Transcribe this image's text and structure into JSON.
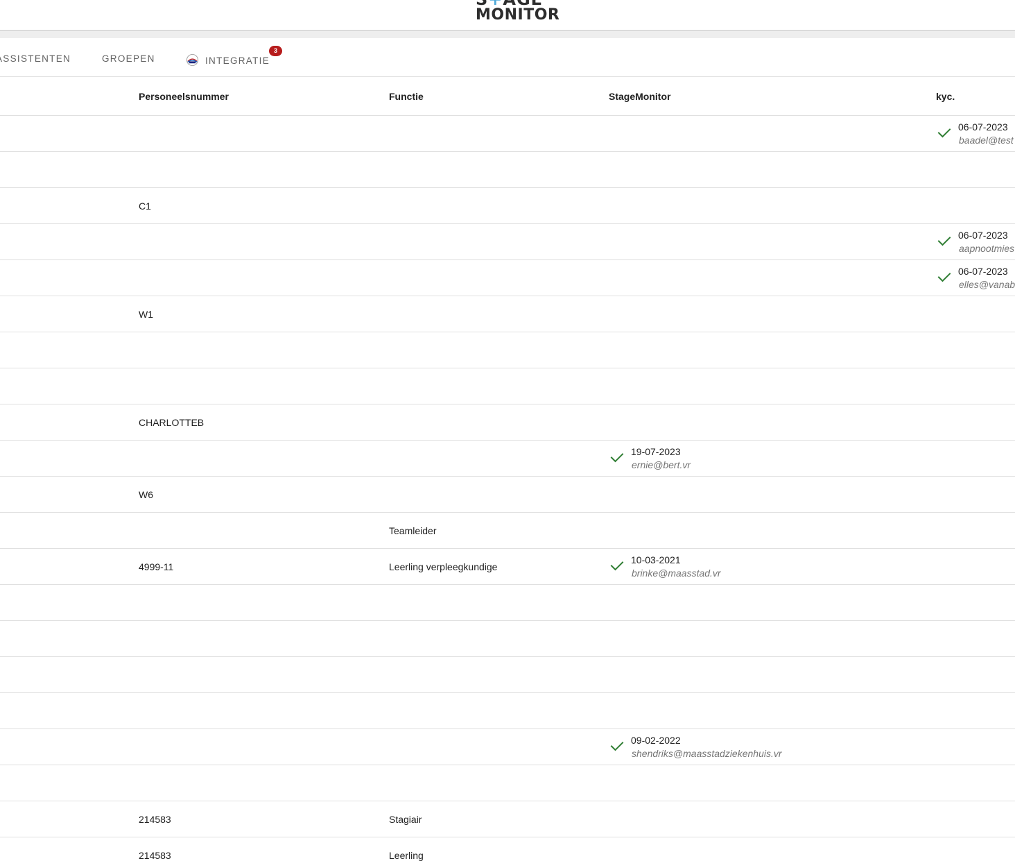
{
  "header": {
    "logo_top_left": "S",
    "logo_top_plus": "+",
    "logo_top_right": "AGE",
    "logo_bottom": "MONITOR"
  },
  "tabs": [
    {
      "label": "ASSISTENTEN"
    },
    {
      "label": "GROEPEN"
    },
    {
      "label": "INTEGRATIE",
      "badge": "3",
      "icon": "integration-logo-icon"
    }
  ],
  "table": {
    "columns": [
      "Personeelsnummer",
      "Functie",
      "StageMonitor",
      "kyc."
    ],
    "rows": [
      {
        "pers": "",
        "func": "",
        "stage": null,
        "kyc": {
          "date": "06-07-2023",
          "email": "baadel@test"
        }
      },
      {
        "pers": "",
        "func": "",
        "stage": null,
        "kyc": null
      },
      {
        "pers": "C1",
        "func": "",
        "stage": null,
        "kyc": null
      },
      {
        "pers": "",
        "func": "",
        "stage": null,
        "kyc": {
          "date": "06-07-2023",
          "email": "aapnootmies"
        }
      },
      {
        "pers": "",
        "func": "",
        "stage": null,
        "kyc": {
          "date": "06-07-2023",
          "email": "elles@vanab"
        }
      },
      {
        "pers": "W1",
        "func": "",
        "stage": null,
        "kyc": null
      },
      {
        "pers": "",
        "func": "",
        "stage": null,
        "kyc": null
      },
      {
        "pers": "",
        "func": "",
        "stage": null,
        "kyc": null
      },
      {
        "pers": "CHARLOTTEB",
        "func": "",
        "stage": null,
        "kyc": null
      },
      {
        "pers": "",
        "func": "",
        "stage": {
          "date": "19-07-2023",
          "email": "ernie@bert.vr"
        },
        "kyc": null
      },
      {
        "pers": "W6",
        "func": "",
        "stage": null,
        "kyc": null
      },
      {
        "pers": "",
        "func": "Teamleider",
        "stage": null,
        "kyc": null
      },
      {
        "pers": "4999-11",
        "func": "Leerling verpleegkundige",
        "stage": {
          "date": "10-03-2021",
          "email": "brinke@maasstad.vr"
        },
        "kyc": null
      },
      {
        "pers": "",
        "func": "",
        "stage": null,
        "kyc": null
      },
      {
        "pers": "",
        "func": "",
        "stage": null,
        "kyc": null
      },
      {
        "pers": "",
        "func": "",
        "stage": null,
        "kyc": null
      },
      {
        "pers": "",
        "func": "",
        "stage": null,
        "kyc": null
      },
      {
        "pers": "",
        "func": "",
        "stage": {
          "date": "09-02-2022",
          "email": "shendriks@maasstadziekenhuis.vr"
        },
        "kyc": null
      },
      {
        "pers": "",
        "func": "",
        "stage": null,
        "kyc": null
      },
      {
        "pers": "214583",
        "func": "Stagiair",
        "stage": null,
        "kyc": null
      },
      {
        "pers": "214583",
        "func": "Leerling",
        "stage": null,
        "kyc": null
      }
    ]
  },
  "colors": {
    "check": "#2e7d32",
    "badge": "#b71c1c",
    "logo_accent": "#4ea9d9"
  }
}
